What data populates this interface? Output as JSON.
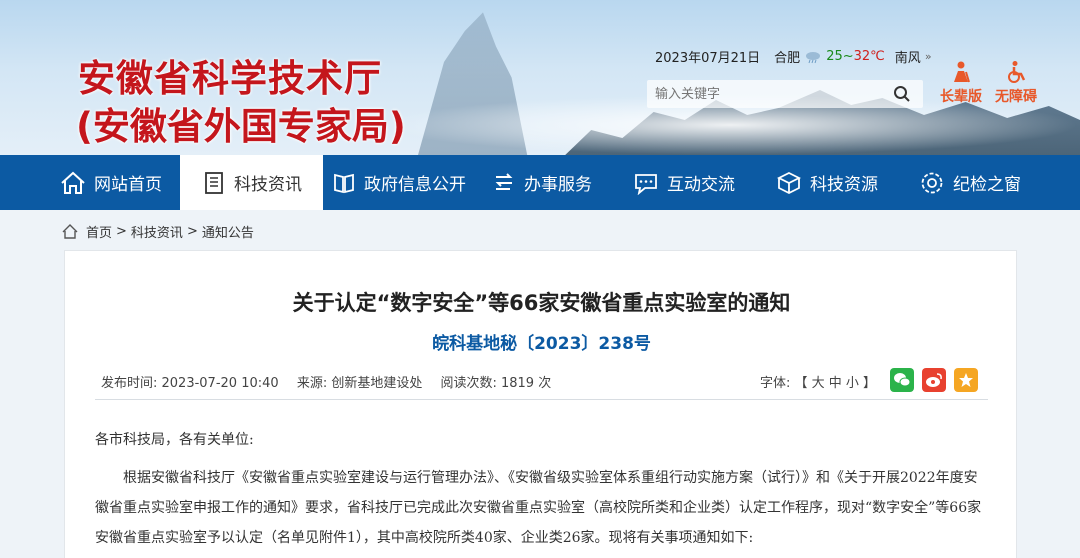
{
  "header": {
    "title_line1": "安徽省科学技术厅",
    "title_line2": "(安徽省外国专家局)",
    "date": "2023年07月21日",
    "city": "合肥",
    "temp_low": "25",
    "temp_sep": "~",
    "temp_high": "32℃",
    "wind": "南风",
    "wind_more": "»",
    "search_placeholder": "输入关键字",
    "elder_label": "长辈版",
    "accessible_label": "无障碍",
    "accent_color": "#c4161c"
  },
  "nav": {
    "items": [
      {
        "label": "网站首页",
        "icon": "home-icon"
      },
      {
        "label": "科技资讯",
        "icon": "document-icon",
        "active": true
      },
      {
        "label": "政府信息公开",
        "icon": "book-icon"
      },
      {
        "label": "办事服务",
        "icon": "service-icon"
      },
      {
        "label": "互动交流",
        "icon": "chat-icon"
      },
      {
        "label": "科技资源",
        "icon": "cube-icon"
      },
      {
        "label": "纪检之窗",
        "icon": "gear-icon"
      }
    ],
    "bg_color": "#0c5aa3"
  },
  "breadcrumb": {
    "home": "首页",
    "sep1": ">",
    "level1": "科技资讯",
    "sep2": ">",
    "level2": "通知公告"
  },
  "article": {
    "title": "关于认定“数字安全”等66家安徽省重点实验室的通知",
    "doc_number": "皖科基地秘〔2023〕238号",
    "publish_time": "发布时间: 2023-07-20 10:40",
    "source": "来源: 创新基地建设处",
    "views": "阅读次数: 1819 次",
    "font_label": "字体: 【 大 中 小 】",
    "salutation": "各市科技局，各有关单位:",
    "paragraph": "根据安徽省科技厅《安徽省重点实验室建设与运行管理办法》、《安徽省级实验室体系重组行动实施方案（试行）》和《关于开展2022年度安徽省重点实验室申报工作的通知》要求，省科技厅已完成此次安徽省重点实验室（高校院所类和企业类）认定工作程序，现对“数字安全”等66家安徽省重点实验室予以认定（名单见附件1），其中高校院所类40家、企业类26家。现将有关事项通知如下:"
  }
}
